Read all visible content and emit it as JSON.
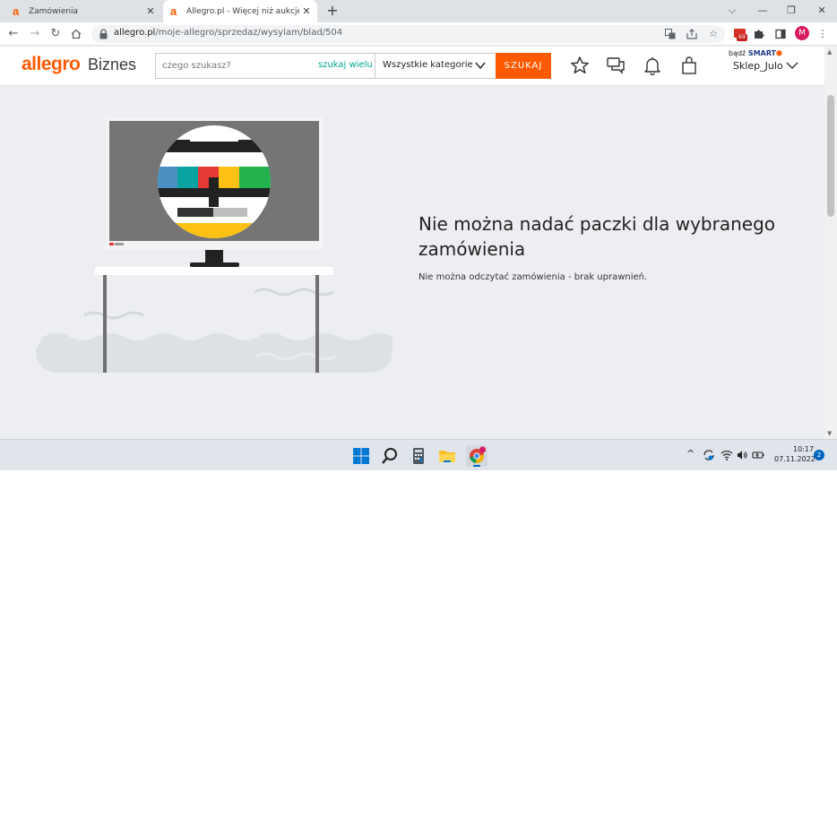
{
  "browser": {
    "tabs": [
      {
        "title": "Zamówienia",
        "favicon": "a"
      },
      {
        "title": "Allegro.pl - Więcej niż aukcje. Naj",
        "favicon": "a"
      }
    ],
    "new_tab": "+",
    "url_host": "allegro.pl",
    "url_path": "/moje-allegro/sprzedaz/wysylam/blad/504",
    "gmail_badge": "69",
    "profile_initial": "M"
  },
  "header": {
    "logo": "allegro",
    "logo_sub": "Biznes",
    "search_placeholder": "czego szukasz?",
    "search_many": "szukaj wielu",
    "category": "Wszystkie kategorie",
    "search_button": "SZUKAJ",
    "smart_prefix": "bądź",
    "smart_brand": "SMART",
    "user_name": "Sklep_Julo"
  },
  "error": {
    "title": "Nie można nadać paczki dla wybranego zamówienia",
    "description": "Nie można odczytać zamówienia - brak uprawnień."
  },
  "taskbar": {
    "time": "10:17",
    "date": "07.11.2022",
    "notifications": "2"
  },
  "colors": {
    "brand": "#ff5a00",
    "accent_link": "#00a790",
    "page_bg": "#eceef1"
  }
}
